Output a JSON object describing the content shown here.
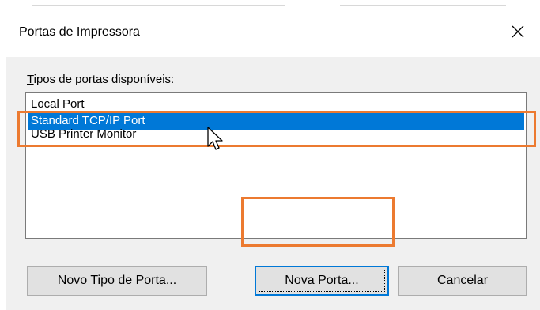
{
  "dialog": {
    "title": "Portas de Impressora",
    "list_label_accel": "T",
    "list_label_rest": "ipos de portas disponíveis:",
    "port_types": [
      {
        "label": "Local Port",
        "selected": false
      },
      {
        "label": "Standard TCP/IP Port",
        "selected": true
      },
      {
        "label": "USB Printer Monitor",
        "selected": false
      }
    ],
    "buttons": {
      "new_type": "Novo Tipo de Porta...",
      "new_port_accel": "N",
      "new_port_rest": "ova Porta...",
      "cancel": "Cancelar"
    }
  },
  "icons": {
    "close": "close-icon",
    "cursor": "mouse-pointer-icon"
  },
  "colors": {
    "selection": "#0078d7",
    "highlight_annotation": "#ec7a30",
    "button_face": "#e1e1e1",
    "dialog_background": "#f0f0f0"
  }
}
